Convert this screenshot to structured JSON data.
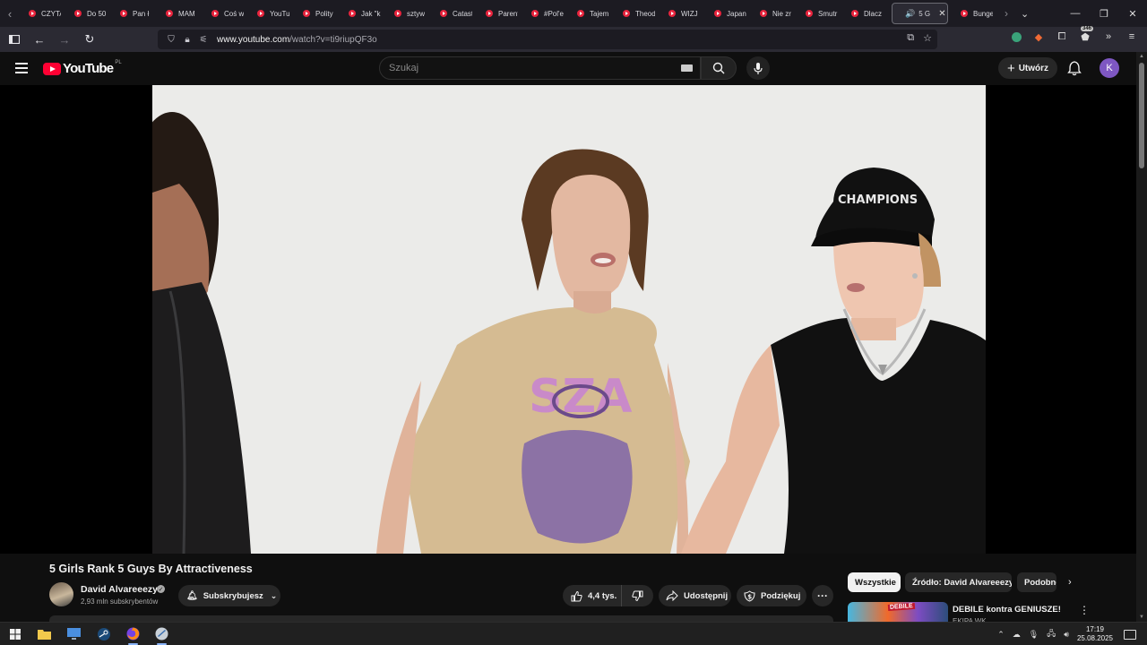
{
  "browser": {
    "tabs": [
      {
        "title": "CZYTA"
      },
      {
        "title": "Do 50"
      },
      {
        "title": "Pan ł"
      },
      {
        "title": "MAM"
      },
      {
        "title": "Coś w"
      },
      {
        "title": "YouTu"
      },
      {
        "title": "Polity"
      },
      {
        "title": "Jak \"k"
      },
      {
        "title": "sztyw"
      },
      {
        "title": "Catast"
      },
      {
        "title": "Parent"
      },
      {
        "title": "#Pol'e"
      },
      {
        "title": "Tajem"
      },
      {
        "title": "Theod"
      },
      {
        "title": "WIZJ"
      },
      {
        "title": "Japan"
      },
      {
        "title": "Nie zr"
      },
      {
        "title": "Smutr"
      },
      {
        "title": "Dlacz"
      }
    ],
    "active_tab": {
      "title": "5 G"
    },
    "trailing_tab": {
      "title": "Bunge"
    },
    "url_domain": "www.youtube.com",
    "url_path": "/watch?v=ti9riupQF3o",
    "extension_badge": "346"
  },
  "youtube": {
    "logo_text": "YouTube",
    "country_code": "PL",
    "search_placeholder": "Szukaj",
    "create_label": "Utwórz",
    "avatar_initial": "K"
  },
  "video": {
    "title": "5 Girls Rank 5 Guys By Attractiveness",
    "channel_name": "David Alvareeezy",
    "subscribers": "2,93 mln subskrybentów",
    "subscribe_label": "Subskrybujesz",
    "likes": "4,4 tys.",
    "share_label": "Udostępnij",
    "thanks_label": "Podziękuj"
  },
  "sidebar": {
    "chips": [
      "Wszystkie",
      "Źródło: David Alvareeezy",
      "Podobne"
    ],
    "recommendation": {
      "title": "DEBILE kontra GENIUSZE!",
      "channel": "EKIPA WK",
      "thumb_text": "DEBILE"
    }
  },
  "taskbar": {
    "time": "17:19",
    "date": "25.08.2025"
  },
  "colors": {
    "yt_red": "#ff0033",
    "avatar_purple": "#7e57c2",
    "browser_bg": "#1c1b22",
    "page_bg": "#0f0f0f"
  }
}
